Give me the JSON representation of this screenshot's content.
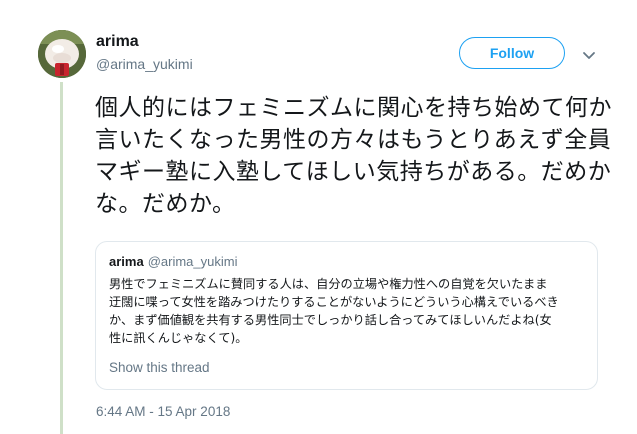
{
  "tweet": {
    "display_name": "arima",
    "handle": "@arima_yukimi",
    "follow_label": "Follow",
    "text": "個人的にはフェミニズムに関心を持ち始めて何か言いたくなった男性の方々はもうとりあえず全員マギー塾に入塾してほしい気持ちがある。だめかな。だめか。",
    "timestamp": "6:44 AM - 15 Apr 2018"
  },
  "quote": {
    "display_name": "arima",
    "handle": "@arima_yukimi",
    "text": "男性でフェミニズムに賛同する人は、自分の立場や権力性への自覚を欠いたまま\n迂闊に喋って女性を踏みつけたりすることがないようにどういう心構えでいるべき\nか、まず価値観を共有する男性同士でしっかり話し合ってみてほしいんだよね(女\n性に訊くんじゃなくて)。",
    "show_thread_label": "Show this thread"
  },
  "colors": {
    "accent": "#1da1f2",
    "secondary_text": "#657786",
    "primary_text": "#14171a",
    "border": "#e1e8ed",
    "thread_line": "#cfe0c8"
  },
  "icons": {
    "avatar": "avatar-image",
    "caret": "chevron-down-icon"
  }
}
